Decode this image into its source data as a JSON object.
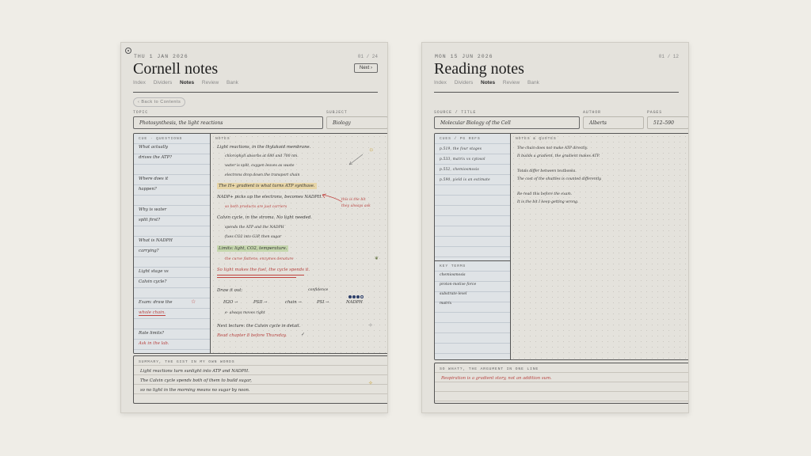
{
  "left": {
    "date": "THU 1 JAN 2026",
    "page_num": "01 / 24",
    "title": "Cornell notes",
    "next_label": "Next ›",
    "tabs": [
      "Index",
      "Dividers",
      "Notes",
      "Review",
      "Bank"
    ],
    "active_tab": "Notes",
    "back_label": "‹ Back to Contents",
    "topic_label": "TOPIC",
    "topic_value": "Photosynthesis, the light reactions",
    "subject_label": "SUBJECT",
    "subject_value": "Biology",
    "cue_header": "CUE · QUESTIONS",
    "notes_header": "NOTES",
    "cues": [
      [
        "What actually",
        "drives the ATP?"
      ],
      [
        "Where does it",
        "happen?"
      ],
      [
        "Why is water",
        "split first?"
      ],
      [
        "What is NADPH",
        "carrying?"
      ],
      [
        "Light stage vs",
        "Calvin cycle?"
      ],
      [
        "Exam: draw the",
        "whole chain."
      ],
      [
        "Rate limits?",
        "Ask in the lab."
      ]
    ],
    "notes_lines": {
      "l1": "Light reactions, in the thylakoid membrane.",
      "l2": "chlorophyll absorbs at 680 and 700 nm.",
      "l3": "water is split, oxygen leaves as waste",
      "l4": "electrons drop down the transport chain",
      "l5": "The H+ gradient is what turns ATP synthase.",
      "l6": "NADP+ picks up the electrons, becomes NADPH.",
      "l7": "so both products are just carriers",
      "l8": "Calvin cycle, in the stroma. No light needed.",
      "l9": "spends the ATP and the NADPH",
      "l10": "fixes CO2 into G3P, then sugar",
      "l11": "Limits: light, CO2, temperature.",
      "l12": "the curve flattens, enzymes denature",
      "l13": "So light makes the fuel, the cycle spends it.",
      "margin_note_1": "this is the bit",
      "margin_note_2": "they always ask",
      "draw_label": "Draw it out:",
      "confidence_label": "confidence",
      "chain": [
        "H2O →",
        "PSII →",
        "chain →",
        "PSI →",
        "NADPH"
      ],
      "chain_note": "e- always moves right",
      "next_lecture": "Next lecture: the Calvin cycle in detail.",
      "read_task": "Read chapter 8 before Thursday."
    },
    "summary_label": "SUMMARY, THE GIST IN MY OWN WORDS",
    "summary_lines": [
      "Light reactions turn sunlight into ATP and NADPH.",
      "The Calvin cycle spends both of them to build sugar,",
      "so no light in the morning means no sugar by noon."
    ]
  },
  "right": {
    "date": "MON 15 JUN 2026",
    "page_num": "01 / 12",
    "title": "Reading notes",
    "tabs": [
      "Index",
      "Dividers",
      "Notes",
      "Review",
      "Bank"
    ],
    "active_tab": "Notes",
    "source_label": "SOURCE / TITLE",
    "source_value": "Molecular Biology of the Cell",
    "author_label": "AUTHOR",
    "author_value": "Alberts",
    "pages_label": "PAGES",
    "pages_value": "512–590",
    "cue_header": "CUES / PG REFS",
    "cues": [
      "p.519, the four stages",
      "p.533, matrix vs cytosol",
      "p.552, chemiosmosis",
      "p.590, yield is an estimate"
    ],
    "notes_header": "NOTES & QUOTES",
    "notes": [
      "The chain does not make ATP directly.",
      "It builds a gradient, the gradient makes ATP.",
      "Totals differ between textbooks.",
      "The cost of the shuttles is counted differently.",
      "Re-read this before the exam.",
      "It is the bit I keep getting wrong."
    ],
    "key_terms_header": "KEY TERMS",
    "key_terms": [
      "chemiosmosis",
      "proton-motive force",
      "substrate-level",
      "matrix"
    ],
    "sowhat_label": "SO WHAT?, THE ARGUMENT IN ONE LINE",
    "sowhat_value": "Respiration is a gradient story, not an addition sum."
  },
  "colors": {
    "accent_red": "#b7423f",
    "highlight_yellow": "#e7d5a7",
    "highlight_green": "#c5d6ad",
    "dot_navy": "#2d3e6a"
  },
  "confidence": {
    "filled": 3,
    "total": 4
  }
}
